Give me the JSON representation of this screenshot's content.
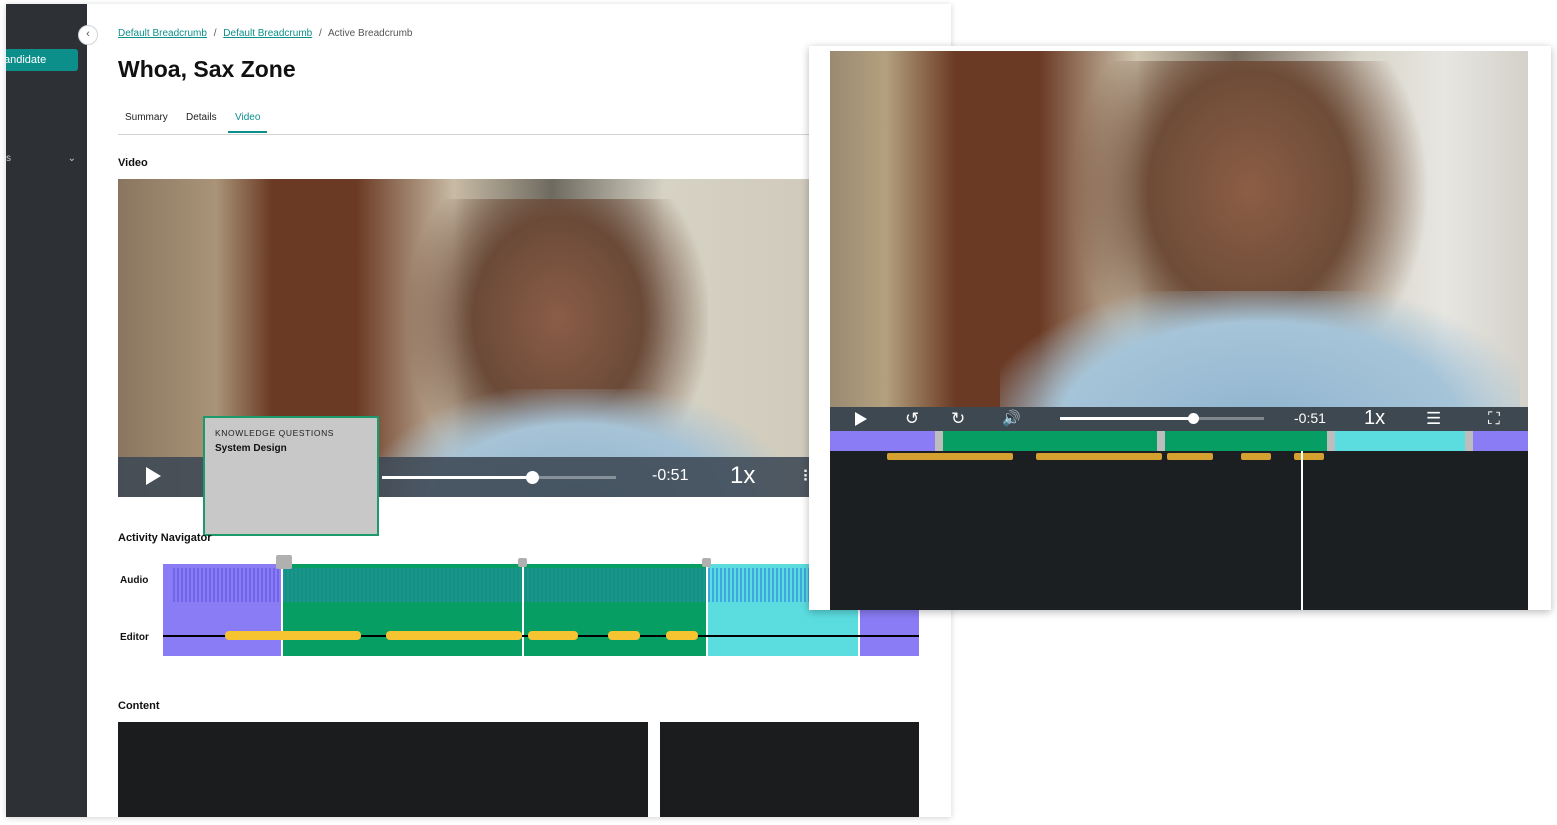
{
  "sidebar": {
    "active_item": "andidate",
    "item_label": "s",
    "collapse_glyph": "‹",
    "chevron_glyph": "⌄"
  },
  "breadcrumb": {
    "items": [
      "Default Breadcrumb",
      "Default Breadcrumb",
      "Active Breadcrumb"
    ],
    "separator": "/"
  },
  "page_title": "Whoa, Sax Zone",
  "tabs": [
    {
      "label": "Summary",
      "active": false
    },
    {
      "label": "Details",
      "active": false
    },
    {
      "label": "Video",
      "active": true
    }
  ],
  "video_section": {
    "label": "Video",
    "time_remaining": "-0:51",
    "speed": "1x",
    "progress": 0.64,
    "menu_glyph": "⠿"
  },
  "tooltip": {
    "kicker": "KNOWLEDGE QUESTIONS",
    "value": "System Design"
  },
  "activity_navigator": {
    "label": "Activity Navigator",
    "rows": [
      "Audio",
      "Editor"
    ]
  },
  "content_section": {
    "label": "Content"
  },
  "zoom_player": {
    "time_remaining": "-0:51",
    "speed": "1x",
    "progress": 0.65,
    "icons": [
      "play-icon",
      "rewind-icon",
      "forward-icon",
      "volume-icon",
      "chapters-icon",
      "fullscreen-icon"
    ],
    "glyphs": {
      "rewind": "↺",
      "forward": "↻",
      "volume": "🔊",
      "chapters": "☰",
      "fullscreen": "⛶"
    }
  },
  "colors": {
    "teal": "#0c8f8a",
    "purple": "#8a7cf5",
    "green": "#069e63",
    "cyan": "#5bdde0",
    "yellow": "#f5c430",
    "tooltip_border": "#1d9a6c"
  }
}
